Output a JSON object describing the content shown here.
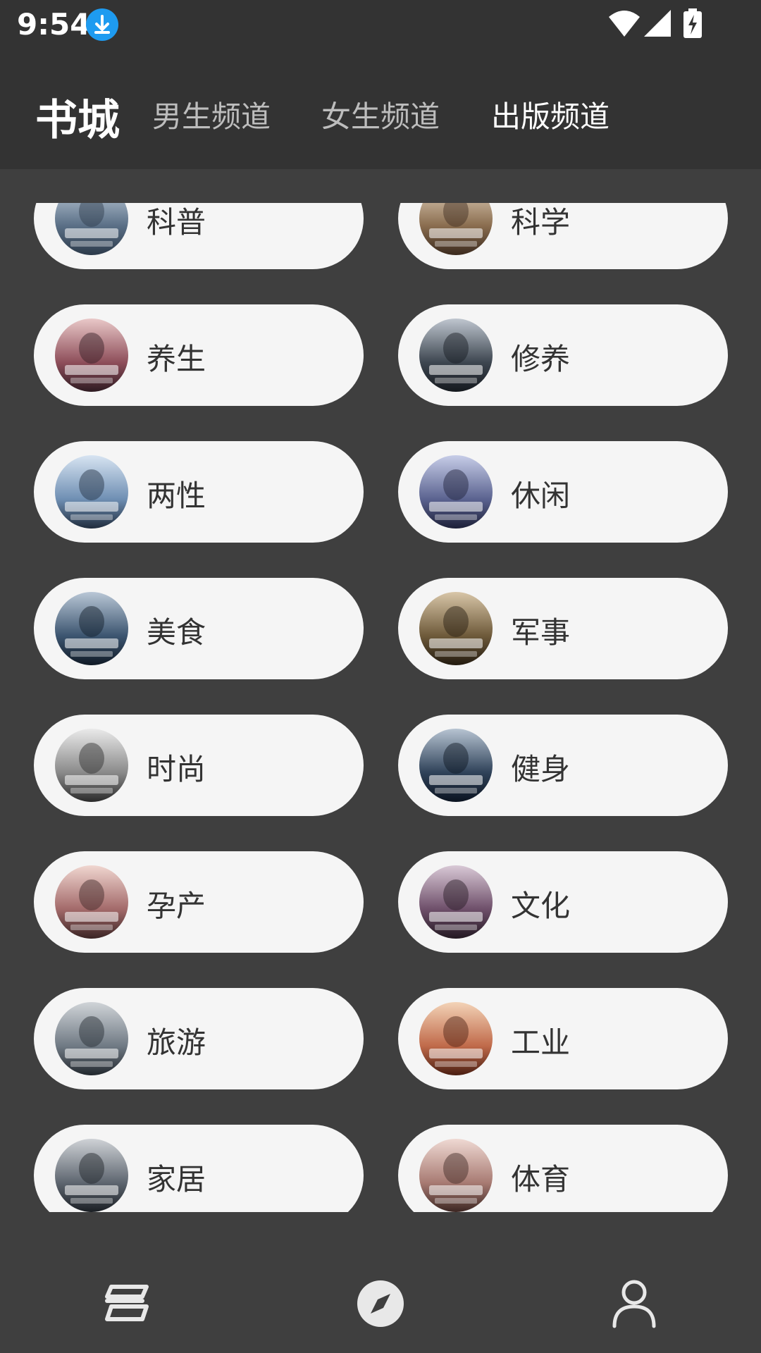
{
  "status_bar": {
    "time": "9:54"
  },
  "header": {
    "title": "书城",
    "tabs": [
      {
        "label": "男生频道",
        "active": false
      },
      {
        "label": "女生频道",
        "active": false
      },
      {
        "label": "出版频道",
        "active": true
      }
    ]
  },
  "categories": [
    {
      "label": "科普",
      "cover": "cover-image"
    },
    {
      "label": "科学",
      "cover": "cover-image"
    },
    {
      "label": "养生",
      "cover": "cover-image"
    },
    {
      "label": "修养",
      "cover": "cover-image"
    },
    {
      "label": "两性",
      "cover": "cover-image"
    },
    {
      "label": "休闲",
      "cover": "cover-image"
    },
    {
      "label": "美食",
      "cover": "cover-image"
    },
    {
      "label": "军事",
      "cover": "cover-image"
    },
    {
      "label": "时尚",
      "cover": "cover-image"
    },
    {
      "label": "健身",
      "cover": "cover-image"
    },
    {
      "label": "孕产",
      "cover": "cover-image"
    },
    {
      "label": "文化",
      "cover": "cover-image"
    },
    {
      "label": "旅游",
      "cover": "cover-image"
    },
    {
      "label": "工业",
      "cover": "cover-image"
    },
    {
      "label": "家居",
      "cover": "cover-image"
    },
    {
      "label": "体育",
      "cover": "cover-image"
    }
  ],
  "bottom_nav": [
    {
      "icon": "bookshelf-icon"
    },
    {
      "icon": "compass-icon"
    },
    {
      "icon": "profile-icon"
    }
  ],
  "colors": {
    "background": "#3f3f3f",
    "header": "#333333",
    "pill": "#f5f5f5",
    "accent_download": "#1e9bf0"
  }
}
